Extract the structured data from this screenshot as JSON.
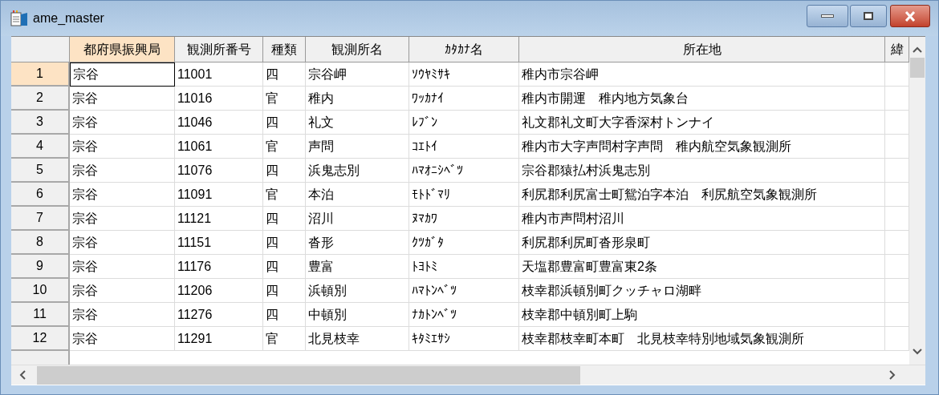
{
  "window": {
    "title": "ame_master"
  },
  "columns": [
    {
      "label": "都府県振興局",
      "selected": true
    },
    {
      "label": "観測所番号",
      "selected": false
    },
    {
      "label": "種類",
      "selected": false
    },
    {
      "label": "観測所名",
      "selected": false
    },
    {
      "label": "ｶﾀｶﾅ名",
      "selected": false
    },
    {
      "label": "所在地",
      "selected": false
    },
    {
      "label": "緯",
      "selected": false
    }
  ],
  "rows": [
    {
      "number": "1",
      "selected": true,
      "cells": [
        "宗谷",
        "11001",
        "四",
        "宗谷岬",
        "ｿｳﾔﾐｻｷ",
        "稚内市宗谷岬"
      ]
    },
    {
      "number": "2",
      "selected": false,
      "cells": [
        "宗谷",
        "11016",
        "官",
        "稚内",
        "ﾜｯｶﾅｲ",
        "稚内市開運　稚内地方気象台"
      ]
    },
    {
      "number": "3",
      "selected": false,
      "cells": [
        "宗谷",
        "11046",
        "四",
        "礼文",
        "ﾚﾌﾞﾝ",
        "礼文郡礼文町大字香深村トンナイ"
      ]
    },
    {
      "number": "4",
      "selected": false,
      "cells": [
        "宗谷",
        "11061",
        "官",
        "声問",
        "ｺｴﾄｲ",
        "稚内市大字声問村字声問　稚内航空気象観測所"
      ]
    },
    {
      "number": "5",
      "selected": false,
      "cells": [
        "宗谷",
        "11076",
        "四",
        "浜鬼志別",
        "ﾊﾏｵﾆｼﾍﾞﾂ",
        "宗谷郡猿払村浜鬼志別"
      ]
    },
    {
      "number": "6",
      "selected": false,
      "cells": [
        "宗谷",
        "11091",
        "官",
        "本泊",
        "ﾓﾄﾄﾞﾏﾘ",
        "利尻郡利尻富士町鴛泊字本泊　利尻航空気象観測所"
      ]
    },
    {
      "number": "7",
      "selected": false,
      "cells": [
        "宗谷",
        "11121",
        "四",
        "沼川",
        "ﾇﾏｶﾜ",
        "稚内市声問村沼川"
      ]
    },
    {
      "number": "8",
      "selected": false,
      "cells": [
        "宗谷",
        "11151",
        "四",
        "沓形",
        "ｸﾂｶﾞﾀ",
        "利尻郡利尻町沓形泉町"
      ]
    },
    {
      "number": "9",
      "selected": false,
      "cells": [
        "宗谷",
        "11176",
        "四",
        "豊富",
        "ﾄﾖﾄﾐ",
        "天塩郡豊富町豊富東2条"
      ]
    },
    {
      "number": "10",
      "selected": false,
      "cells": [
        "宗谷",
        "11206",
        "四",
        "浜頓別",
        "ﾊﾏﾄﾝﾍﾞﾂ",
        "枝幸郡浜頓別町クッチャロ湖畔"
      ]
    },
    {
      "number": "11",
      "selected": false,
      "cells": [
        "宗谷",
        "11276",
        "四",
        "中頓別",
        "ﾅｶﾄﾝﾍﾞﾂ",
        "枝幸郡中頓別町上駒"
      ]
    },
    {
      "number": "12",
      "selected": false,
      "cells": [
        "宗谷",
        "11291",
        "官",
        "北見枝幸",
        "ｷﾀﾐｴｻｼ",
        "枝幸郡枝幸町本町　北見枝幸特別地域気象観測所"
      ]
    }
  ]
}
